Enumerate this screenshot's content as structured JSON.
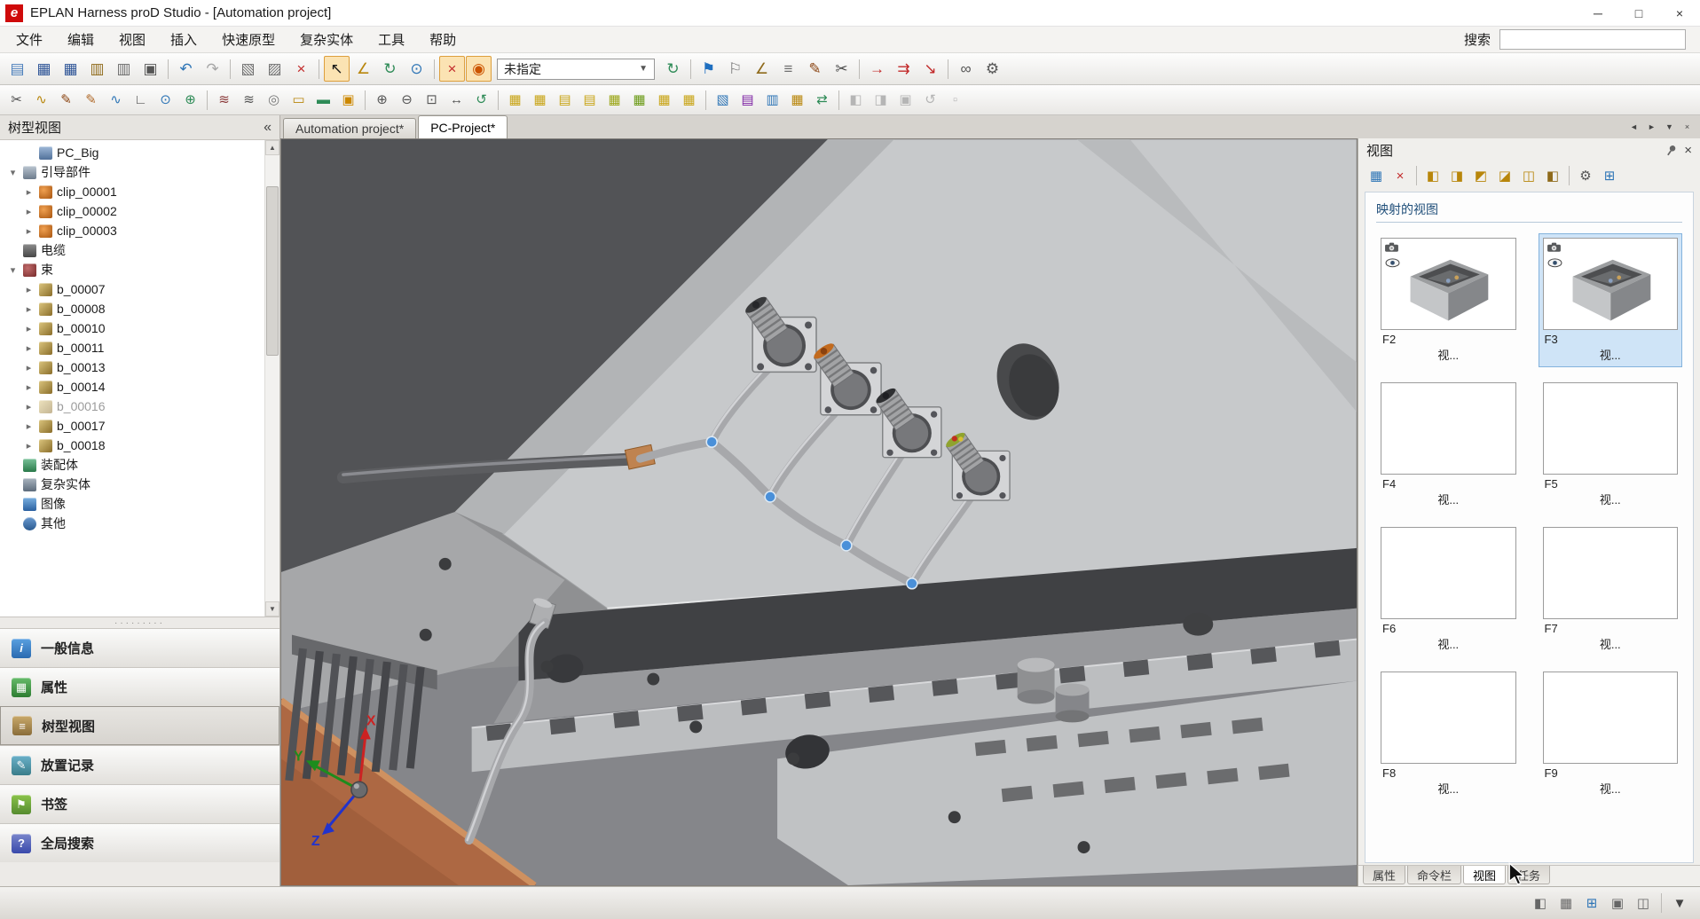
{
  "window": {
    "logo": "e",
    "title": "EPLAN Harness proD Studio - [Automation project]",
    "minimize": "─",
    "maximize": "□",
    "close": "×"
  },
  "menu": {
    "items": [
      {
        "name": "menu-file",
        "label": "文件"
      },
      {
        "name": "menu-edit",
        "label": "编辑"
      },
      {
        "name": "menu-view",
        "label": "视图"
      },
      {
        "name": "menu-insert",
        "label": "插入"
      },
      {
        "name": "menu-rapid-prototyping",
        "label": "快速原型"
      },
      {
        "name": "menu-complex-solids",
        "label": "复杂实体"
      },
      {
        "name": "menu-tools",
        "label": "工具"
      },
      {
        "name": "menu-help",
        "label": "帮助"
      }
    ],
    "search_label": "搜索",
    "search_value": ""
  },
  "toolbar_main": {
    "preset_value": "未指定",
    "buttons": [
      {
        "name": "new-document",
        "glyph": "▤",
        "color": "#4a7ebb"
      },
      {
        "name": "save",
        "glyph": "▦",
        "color": "#2f5597"
      },
      {
        "name": "save-all",
        "glyph": "▦",
        "color": "#2f5597"
      },
      {
        "name": "export-document",
        "glyph": "▥",
        "color": "#8f6a1a"
      },
      {
        "name": "document-settings",
        "glyph": "▥",
        "color": "#6a6a6a"
      },
      {
        "name": "print",
        "glyph": "▣",
        "color": "#555555"
      },
      {
        "sep": true
      },
      {
        "name": "undo",
        "glyph": "↶",
        "color": "#2e75b6"
      },
      {
        "name": "redo",
        "glyph": "↷",
        "color": "#a6a6a6"
      },
      {
        "sep": true
      },
      {
        "name": "copy",
        "glyph": "▧",
        "color": "#6f6f6f"
      },
      {
        "name": "paste",
        "glyph": "▨",
        "color": "#6f6f6f"
      },
      {
        "name": "delete",
        "glyph": "×",
        "color": "#c22a2a"
      },
      {
        "sep": true
      },
      {
        "name": "select",
        "glyph": "↖",
        "color": "#1a1a1a",
        "selected": true
      },
      {
        "name": "measure-angle",
        "glyph": "∠",
        "color": "#b8860b"
      },
      {
        "name": "rotate-tool",
        "glyph": "↻",
        "color": "#2e8b57"
      },
      {
        "name": "control-point",
        "glyph": "⊙",
        "color": "#2e75b6"
      },
      {
        "sep": true
      },
      {
        "name": "collision-ignore",
        "glyph": "×",
        "color": "#c22a2a",
        "selected": true
      },
      {
        "name": "collision-check",
        "glyph": "◉",
        "color": "#cc5500",
        "selected": true
      },
      {
        "combo": true
      },
      {
        "name": "refresh",
        "glyph": "↻",
        "color": "#2e8b57"
      },
      {
        "sep": true
      },
      {
        "name": "navigate-next-flag",
        "glyph": "⚑",
        "color": "#1f6fc0"
      },
      {
        "name": "navigate-prev-flag",
        "glyph": "⚐",
        "color": "#6f6f6f"
      },
      {
        "name": "measure",
        "glyph": "∠",
        "color": "#8f6a1a"
      },
      {
        "name": "display-grid",
        "glyph": "≡",
        "color": "#6f6f6f"
      },
      {
        "name": "annotate-pen",
        "glyph": "✎",
        "color": "#8b4513"
      },
      {
        "name": "trim",
        "glyph": "✂",
        "color": "#4a4a4a"
      },
      {
        "sep": true
      },
      {
        "name": "place-wire",
        "glyph": "→",
        "color": "#c22a2a"
      },
      {
        "name": "place-bundle",
        "glyph": "⇉",
        "color": "#c22a2a"
      },
      {
        "name": "place-route",
        "glyph": "↘",
        "color": "#c22a2a"
      },
      {
        "sep": true
      },
      {
        "name": "attach",
        "glyph": "∞",
        "color": "#555555"
      },
      {
        "name": "tool-options",
        "glyph": "⚙",
        "color": "#555555"
      }
    ]
  },
  "toolbar_secondary": {
    "buttons": [
      {
        "name": "cut-segment",
        "glyph": "✂",
        "color": "#4a4a4a"
      },
      {
        "name": "splice",
        "glyph": "∿",
        "color": "#b8860b"
      },
      {
        "name": "draw-pen",
        "glyph": "✎",
        "color": "#8b4513"
      },
      {
        "name": "draw-pencil",
        "glyph": "✎",
        "color": "#b06a2a"
      },
      {
        "name": "spline",
        "glyph": "∿",
        "color": "#2e75b6"
      },
      {
        "name": "corner",
        "glyph": "∟",
        "color": "#555555"
      },
      {
        "name": "insert-node",
        "glyph": "⊙",
        "color": "#2e75b6"
      },
      {
        "name": "junction",
        "glyph": "⊕",
        "color": "#2e8b57"
      },
      {
        "sep": true
      },
      {
        "name": "new-bundle",
        "glyph": "≋",
        "color": "#8b3a3a"
      },
      {
        "name": "new-cable",
        "glyph": "≋",
        "color": "#555555"
      },
      {
        "name": "wrap-spiral",
        "glyph": "◎",
        "color": "#777777"
      },
      {
        "name": "protective-sleeve",
        "glyph": "▭",
        "color": "#b8860b"
      },
      {
        "name": "tape",
        "glyph": "▬",
        "color": "#2e8b57"
      },
      {
        "name": "cable-label",
        "glyph": "▣",
        "color": "#cc8800"
      },
      {
        "sep": true
      },
      {
        "name": "zoom-in",
        "glyph": "⊕",
        "color": "#555555"
      },
      {
        "name": "zoom-out",
        "glyph": "⊖",
        "color": "#555555"
      },
      {
        "name": "zoom-fit",
        "glyph": "⊡",
        "color": "#555555"
      },
      {
        "name": "pan",
        "glyph": "↔",
        "color": "#555555"
      },
      {
        "name": "orbit",
        "glyph": "↺",
        "color": "#2e8b57"
      },
      {
        "sep": true
      },
      {
        "name": "table-export",
        "glyph": "▦",
        "color": "#c8a415"
      },
      {
        "name": "table-import",
        "glyph": "▦",
        "color": "#c8a415"
      },
      {
        "name": "table-move-up",
        "glyph": "▤",
        "color": "#c8a415"
      },
      {
        "name": "table-move-down",
        "glyph": "▤",
        "color": "#c8a415"
      },
      {
        "name": "table-sync",
        "glyph": "▦",
        "color": "#9aa515"
      },
      {
        "name": "table-validate",
        "glyph": "▦",
        "color": "#6a9a15"
      },
      {
        "name": "table-edit",
        "glyph": "▦",
        "color": "#c8a415"
      },
      {
        "name": "table-settings",
        "glyph": "▦",
        "color": "#c8a415"
      },
      {
        "sep": true
      },
      {
        "name": "nailboard-view",
        "glyph": "▧",
        "color": "#2e75b6"
      },
      {
        "name": "drawing-sheet",
        "glyph": "▤",
        "color": "#7b1fa2"
      },
      {
        "name": "report",
        "glyph": "▥",
        "color": "#2e75b6"
      },
      {
        "name": "bill-of-materials",
        "glyph": "▦",
        "color": "#b8860b"
      },
      {
        "name": "sync-project",
        "glyph": "⇄",
        "color": "#2e8b57"
      },
      {
        "sep": true
      },
      {
        "name": "compare",
        "glyph": "◧",
        "color": "#b5b5b5"
      },
      {
        "name": "merge",
        "glyph": "◨",
        "color": "#b5b5b5"
      },
      {
        "name": "archive",
        "glyph": "▣",
        "color": "#b5b5b5"
      },
      {
        "name": "history",
        "glyph": "↺",
        "color": "#b5b5b5"
      },
      {
        "name": "plugin",
        "glyph": "▫",
        "color": "#b5b5b5"
      }
    ]
  },
  "doc_tabs": {
    "tabs": [
      {
        "label": "Automation project*",
        "active": false
      },
      {
        "label": "PC-Project*",
        "active": true
      }
    ],
    "controls": [
      {
        "name": "tab-scroll-left",
        "glyph": "◄"
      },
      {
        "name": "tab-scroll-right",
        "glyph": "►"
      },
      {
        "name": "tab-list",
        "glyph": "▼"
      },
      {
        "name": "tab-close",
        "glyph": "×"
      }
    ]
  },
  "left_panel": {
    "title": "树型视图",
    "collapse_glyph": "«",
    "tree": [
      {
        "label": "PC_Big",
        "level": 1,
        "icon": "pc",
        "exp": ""
      },
      {
        "label": "引导部件",
        "level": 0,
        "icon": "guide",
        "exp": "open"
      },
      {
        "label": "clip_00001",
        "level": 1,
        "icon": "clip",
        "exp": "closed"
      },
      {
        "label": "clip_00002",
        "level": 1,
        "icon": "clip",
        "exp": "closed"
      },
      {
        "label": "clip_00003",
        "level": 1,
        "icon": "clip",
        "exp": "closed"
      },
      {
        "label": "电缆",
        "level": 0,
        "icon": "cable",
        "exp": ""
      },
      {
        "label": "束",
        "level": 0,
        "icon": "bundle",
        "exp": "open"
      },
      {
        "label": "b_00007",
        "level": 1,
        "icon": "strand",
        "exp": "closed"
      },
      {
        "label": "b_00008",
        "level": 1,
        "icon": "strand",
        "exp": "closed"
      },
      {
        "label": "b_00010",
        "level": 1,
        "icon": "strand",
        "exp": "closed"
      },
      {
        "label": "b_00011",
        "level": 1,
        "icon": "strand",
        "exp": "closed"
      },
      {
        "label": "b_00013",
        "level": 1,
        "icon": "strand",
        "exp": "closed"
      },
      {
        "label": "b_00014",
        "level": 1,
        "icon": "strand",
        "exp": "closed"
      },
      {
        "label": "b_00016",
        "level": 1,
        "icon": "strand",
        "exp": "closed",
        "grayed": true
      },
      {
        "label": "b_00017",
        "level": 1,
        "icon": "strand",
        "exp": "closed"
      },
      {
        "label": "b_00018",
        "level": 1,
        "icon": "strand",
        "exp": "closed"
      },
      {
        "label": "装配体",
        "level": 0,
        "icon": "assembly",
        "exp": ""
      },
      {
        "label": "复杂实体",
        "level": 0,
        "icon": "complex",
        "exp": ""
      },
      {
        "label": "图像",
        "level": 0,
        "icon": "image",
        "exp": ""
      },
      {
        "label": "其他",
        "level": 0,
        "icon": "other",
        "exp": ""
      }
    ],
    "nav_buttons": [
      {
        "name": "general-info",
        "label": "一般信息",
        "icon": "info"
      },
      {
        "name": "properties",
        "label": "属性",
        "icon": "props"
      },
      {
        "name": "tree-view",
        "label": "树型视图",
        "icon": "tree",
        "active": true
      },
      {
        "name": "placement-record",
        "label": "放置记录",
        "icon": "placement"
      },
      {
        "name": "bookmarks",
        "label": "书签",
        "icon": "bookmark"
      },
      {
        "name": "global-search",
        "label": "全局搜索",
        "icon": "search"
      }
    ]
  },
  "viewport": {
    "axes": {
      "x": "X",
      "y": "Y",
      "z": "Z"
    }
  },
  "right_panel": {
    "title": "视图",
    "group_title": "映射的视图",
    "toolbar": [
      {
        "name": "create-view",
        "glyph": "▦",
        "color": "#2e75b6"
      },
      {
        "name": "delete-view",
        "glyph": "×",
        "color": "#c22a2a"
      },
      {
        "sep": true
      },
      {
        "name": "view-iso",
        "glyph": "◧",
        "color": "#b8860b"
      },
      {
        "name": "view-front",
        "glyph": "◨",
        "color": "#b8860b"
      },
      {
        "name": "view-top",
        "glyph": "◩",
        "color": "#b8860b"
      },
      {
        "name": "view-left",
        "glyph": "◪",
        "color": "#b8860b"
      },
      {
        "name": "view-right",
        "glyph": "◫",
        "color": "#b8860b"
      },
      {
        "name": "view-back",
        "glyph": "◧",
        "color": "#8f6a1a"
      },
      {
        "sep": true
      },
      {
        "name": "view-settings",
        "glyph": "⚙",
        "color": "#555555"
      },
      {
        "name": "view-layout",
        "glyph": "⊞",
        "color": "#2e75b6"
      }
    ],
    "thumbnails": [
      {
        "id": "F2",
        "caption": "视...",
        "has_image": true,
        "selected": false
      },
      {
        "id": "F3",
        "caption": "视...",
        "has_image": true,
        "selected": true
      },
      {
        "id": "F4",
        "caption": "视...",
        "has_image": false,
        "selected": false
      },
      {
        "id": "F5",
        "caption": "视...",
        "has_image": false,
        "selected": false
      },
      {
        "id": "F6",
        "caption": "视...",
        "has_image": false,
        "selected": false
      },
      {
        "id": "F7",
        "caption": "视...",
        "has_image": false,
        "selected": false
      },
      {
        "id": "F8",
        "caption": "视...",
        "has_image": false,
        "selected": false
      },
      {
        "id": "F9",
        "caption": "视...",
        "has_image": false,
        "selected": false
      }
    ],
    "bottom_tabs": [
      {
        "label": "属性",
        "active": false
      },
      {
        "label": "命令栏",
        "active": false
      },
      {
        "label": "视图",
        "active": true
      },
      {
        "label": "任务",
        "active": false
      }
    ]
  },
  "status_bar": {
    "buttons": [
      {
        "name": "render-mode",
        "glyph": "◧",
        "color": "#666666"
      },
      {
        "name": "wireframe-toggle",
        "glyph": "▦",
        "color": "#666666"
      },
      {
        "name": "grid-toggle",
        "glyph": "⊞",
        "color": "#2e75b6"
      },
      {
        "name": "snap-toggle",
        "glyph": "▣",
        "color": "#666666"
      },
      {
        "name": "monitor-display",
        "glyph": "◫",
        "color": "#666666"
      },
      {
        "sep": true
      },
      {
        "name": "view-options-dropdown",
        "glyph": "▼",
        "color": "#444444"
      }
    ]
  }
}
